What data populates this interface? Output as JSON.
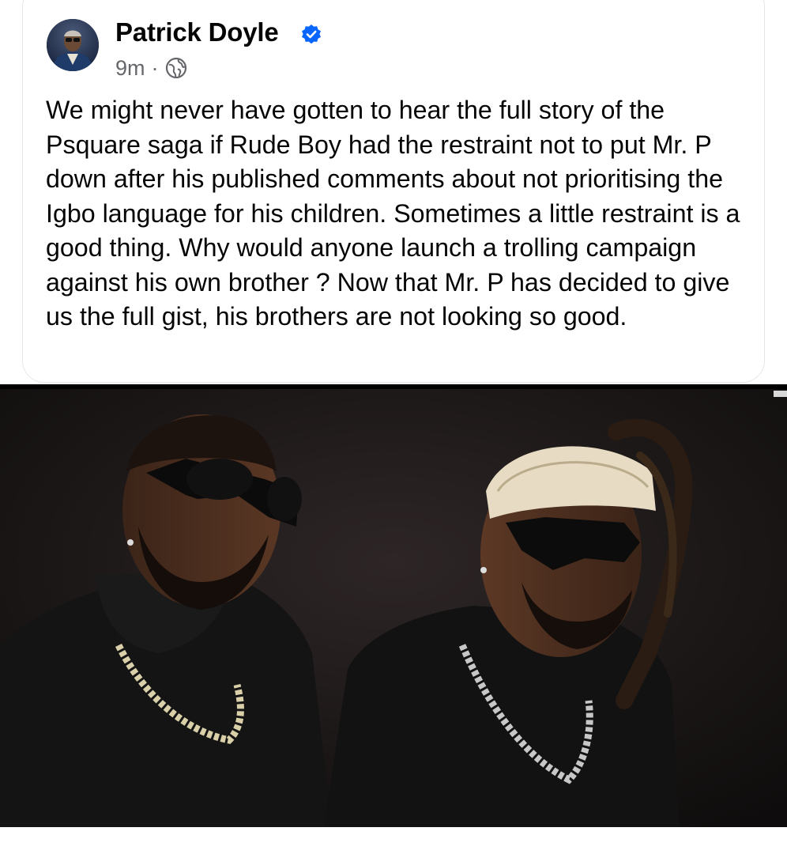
{
  "post": {
    "author": "Patrick Doyle",
    "verified": true,
    "timestamp": "9m",
    "separator": "·",
    "audience_icon": "globe-icon",
    "text": "We might never have gotten to hear the full story of the Psquare saga if Rude Boy had the restraint not to put Mr. P down after his published comments about not prioritising the Igbo language for his children. Sometimes a little restraint is a good thing. Why would anyone launch a trolling campaign against his own brother ? Now that Mr. P has decided to give us the full gist, his brothers are not looking so good."
  },
  "icons": {
    "verified": "verified-badge-icon",
    "audience": "globe-icon"
  },
  "colors": {
    "verified_blue": "#0866ff",
    "meta_gray": "#65676b",
    "text": "#050505"
  }
}
